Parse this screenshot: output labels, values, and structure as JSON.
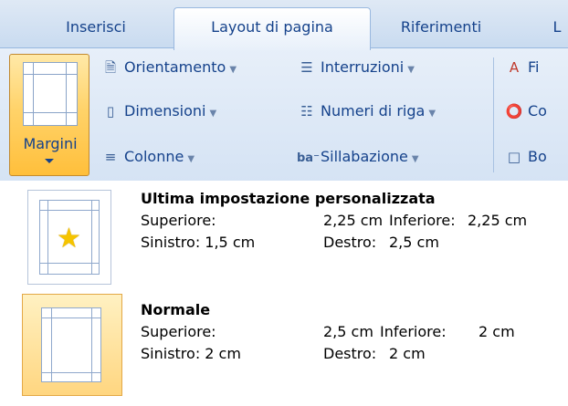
{
  "tabs": [
    {
      "label": "Inserisci",
      "active": false
    },
    {
      "label": "Layout di pagina",
      "active": true
    },
    {
      "label": "Riferimenti",
      "active": false
    },
    {
      "label": "L",
      "active": false
    }
  ],
  "ribbon": {
    "margini_label": "Margini",
    "col1": [
      "Orientamento",
      "Dimensioni",
      "Colonne"
    ],
    "col2": [
      "Interruzioni",
      "Numeri di riga",
      "Sillabazione"
    ],
    "col3": [
      "Fi",
      "Co",
      "Bo"
    ],
    "sillabazione_icon": "ba⁻"
  },
  "gallery": {
    "items": [
      {
        "title": "Ultima impostazione personalizzata",
        "superiore_label": "Superiore:",
        "superiore_value": "2,25 cm",
        "inferiore_label": "Inferiore:",
        "inferiore_value": "2,25 cm",
        "sinistro": "Sinistro: 1,5 cm",
        "destro_label": "Destro:",
        "destro_value": "2,5 cm"
      },
      {
        "title": "Normale",
        "superiore_label": "Superiore:",
        "superiore_value": "2,5 cm",
        "inferiore_label": "Inferiore:",
        "inferiore_value": "2 cm",
        "sinistro": "Sinistro: 2 cm",
        "destro_label": "Destro:",
        "destro_value": "2 cm"
      }
    ]
  },
  "colors": {
    "ribbon_text": "#15428b",
    "selected_fill": "#ffd680",
    "star": "#f5c400"
  }
}
